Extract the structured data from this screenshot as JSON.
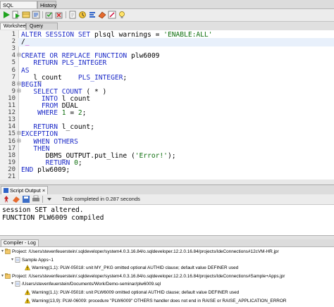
{
  "top_tabs": [
    {
      "label": "SQL Worksheet",
      "active": true
    },
    {
      "label": "History",
      "active": false
    }
  ],
  "toolbar_icons": [
    "run-statement-icon",
    "run-script-icon",
    "autotrace-icon",
    "explain-plan-icon",
    "commit-icon",
    "rollback-icon",
    "clear-icon",
    "sql-tuning-icon",
    "format-icon",
    "eraser-icon",
    "highlight-icon",
    "lightbulb-icon"
  ],
  "subtabs": [
    {
      "label": "Worksheet",
      "active": true
    },
    {
      "label": "Query Builder",
      "active": false
    }
  ],
  "editor": {
    "lines": [
      {
        "n": "1",
        "fold": "",
        "tokens": [
          [
            "kw",
            "ALTER SESSION SET "
          ],
          [
            "plain",
            "plsql_warnings = "
          ],
          [
            "str",
            "'ENABLE:ALL'"
          ],
          [
            "ph",
            "_"
          ]
        ]
      },
      {
        "n": "2",
        "fold": "",
        "tokens": [
          [
            "plain",
            "/"
          ],
          [
            "ph",
            "_"
          ]
        ],
        "hl": true
      },
      {
        "n": "3",
        "fold": "",
        "tokens": []
      },
      {
        "n": "4",
        "fold": "⊟",
        "tokens": [
          [
            "kw",
            "CREATE OR REPLACE FUNCTION "
          ],
          [
            "plain",
            "plw6009"
          ]
        ]
      },
      {
        "n": "5",
        "fold": "",
        "tokens": [
          [
            "kw",
            "   RETURN PLS_INTEGER"
          ]
        ]
      },
      {
        "n": "6",
        "fold": "",
        "tokens": [
          [
            "kw",
            "AS"
          ]
        ]
      },
      {
        "n": "7",
        "fold": "",
        "tokens": [
          [
            "plain",
            "   l_count    "
          ],
          [
            "kw",
            "PLS_INTEGER"
          ],
          [
            "plain",
            ";"
          ]
        ]
      },
      {
        "n": "8",
        "fold": "⊟",
        "tokens": [
          [
            "kw",
            "BEGIN"
          ]
        ]
      },
      {
        "n": "9",
        "fold": "⊟",
        "tokens": [
          [
            "kw",
            "   SELECT COUNT "
          ],
          [
            "plain",
            "( * )"
          ]
        ]
      },
      {
        "n": "10",
        "fold": "",
        "tokens": [
          [
            "kw",
            "     INTO "
          ],
          [
            "plain",
            "l_count"
          ]
        ]
      },
      {
        "n": "11",
        "fold": "",
        "tokens": [
          [
            "kw",
            "     FROM "
          ],
          [
            "plain",
            "DUAL"
          ]
        ]
      },
      {
        "n": "12",
        "fold": "",
        "tokens": [
          [
            "kw",
            "    WHERE "
          ],
          [
            "num",
            "1"
          ],
          [
            "plain",
            " = "
          ],
          [
            "num",
            "2"
          ],
          [
            "plain",
            ";"
          ]
        ]
      },
      {
        "n": "13",
        "fold": "",
        "tokens": []
      },
      {
        "n": "14",
        "fold": "",
        "tokens": [
          [
            "kw",
            "   RETURN "
          ],
          [
            "plain",
            "l_count;"
          ]
        ]
      },
      {
        "n": "15",
        "fold": "⊟",
        "tokens": [
          [
            "kw",
            "EXCEPTION"
          ]
        ]
      },
      {
        "n": "16",
        "fold": "⊟",
        "tokens": [
          [
            "kw",
            "   WHEN OTHERS"
          ]
        ]
      },
      {
        "n": "17",
        "fold": "",
        "tokens": [
          [
            "kw",
            "   THEN"
          ]
        ]
      },
      {
        "n": "18",
        "fold": "",
        "tokens": [
          [
            "plain",
            "      DBMS_OUTPUT.put_line ("
          ],
          [
            "str",
            "'Error!'"
          ],
          [
            "plain",
            ");"
          ]
        ]
      },
      {
        "n": "19",
        "fold": "",
        "tokens": [
          [
            "kw",
            "      RETURN "
          ],
          [
            "num",
            "0"
          ],
          [
            "plain",
            ";"
          ]
        ]
      },
      {
        "n": "20",
        "fold": "",
        "tokens": [
          [
            "kw",
            "END "
          ],
          [
            "plain",
            "plw6009;"
          ]
        ]
      },
      {
        "n": "21",
        "fold": "",
        "tokens": []
      }
    ]
  },
  "script_output": {
    "tab_label": "Script Output",
    "status": "Task completed in 0.287 seconds",
    "lines": [
      "session SET altered.",
      "FUNCTION PLW6009 compiled"
    ]
  },
  "compiler_log": {
    "tab_label": "Compiler - Log",
    "rows": [
      {
        "indent": 0,
        "icon": "project-icon",
        "text": "Project: /Users/stevenfeuerstein/.sqldeveloper/system4.0.3.16.84/o.sqldeveloper.12.2.0.16.84/projects/IdeConnections#12cVM-HR.jpr"
      },
      {
        "indent": 1,
        "icon": "file-icon",
        "text": "Sample Apps~1"
      },
      {
        "indent": 2,
        "icon": "warning-icon",
        "text": "Warning(1,1): PLW-05018: unit MY_PKG omitted optional AUTHID clause; default value DEFINER used"
      },
      {
        "indent": 0,
        "icon": "project-icon",
        "text": "Project: /Users/stevenfeuerstein/.sqldeveloper/system4.0.3.16.84/o.sqldeveloper.12.2.0.16.84/projects/IdeConnections#Sample+Apps.jpr"
      },
      {
        "indent": 1,
        "icon": "file-icon",
        "text": "/Users/stevenfeuerstein/Documents/Work/Demo-seminar/plw6009.sql"
      },
      {
        "indent": 2,
        "icon": "warning-icon",
        "text": "Warning(1,1): PLW-05018: unit PLW6009 omitted optional AUTHID clause; default value DEFINER used"
      },
      {
        "indent": 2,
        "icon": "warning-icon",
        "text": "Warning(13,9): PLW-06009: procedure \"PLW6009\" OTHERS handler does not end in RAISE or RAISE_APPLICATION_ERROR"
      }
    ]
  },
  "colors": {
    "keyword": "#1d2bc8",
    "string": "#0e6f0e",
    "caret_line": "#e8f0fb",
    "warning": "#e8b400"
  }
}
